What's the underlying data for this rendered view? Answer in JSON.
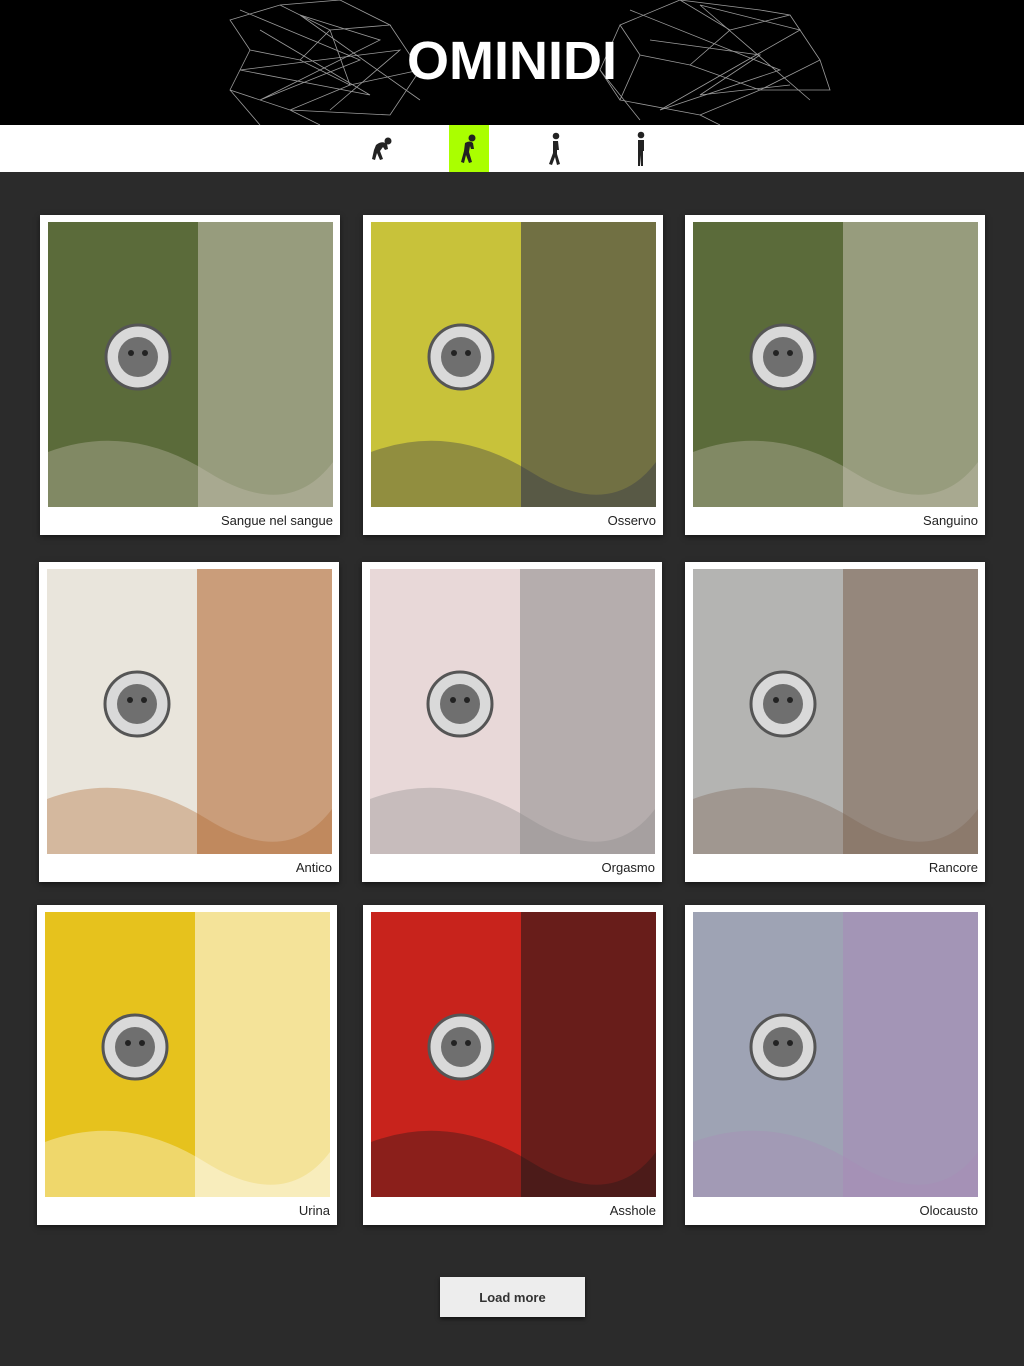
{
  "header": {
    "title": "OMINIDI"
  },
  "nav": {
    "items": [
      {
        "icon": "crouching-figure-icon",
        "active": false
      },
      {
        "icon": "bent-figure-icon",
        "active": true
      },
      {
        "icon": "walking-figure-icon",
        "active": false
      },
      {
        "icon": "upright-figure-icon",
        "active": false
      }
    ],
    "active_color": "#aaff00"
  },
  "gallery": {
    "items": [
      {
        "caption": "Sangue nel sangue",
        "colors": [
          "#5b6b3a",
          "#c9c4b4"
        ]
      },
      {
        "caption": "Osservo",
        "colors": [
          "#c8c23a",
          "#2a2d4a"
        ]
      },
      {
        "caption": "Sanguino",
        "colors": [
          "#5b6b3a",
          "#c9c4b4"
        ]
      },
      {
        "caption": "Antico",
        "colors": [
          "#e9e5dc",
          "#b0632a"
        ]
      },
      {
        "caption": "Orgasmo",
        "colors": [
          "#e8d8d8",
          "#8a8a8a"
        ]
      },
      {
        "caption": "Rancore",
        "colors": [
          "#b4b4b2",
          "#7b6250"
        ]
      },
      {
        "caption": "Urina",
        "colors": [
          "#e6c21d",
          "#ffffff"
        ]
      },
      {
        "caption": "Asshole",
        "colors": [
          "#c8231c",
          "#1a1a1a"
        ]
      },
      {
        "caption": "Olocausto",
        "colors": [
          "#9ea3b4",
          "#a88ab8"
        ]
      }
    ]
  },
  "load_more": {
    "label": "Load more"
  },
  "colors": {
    "header_bg": "#000000",
    "page_bg": "#2b2b2b",
    "nav_bg": "#ffffff"
  }
}
